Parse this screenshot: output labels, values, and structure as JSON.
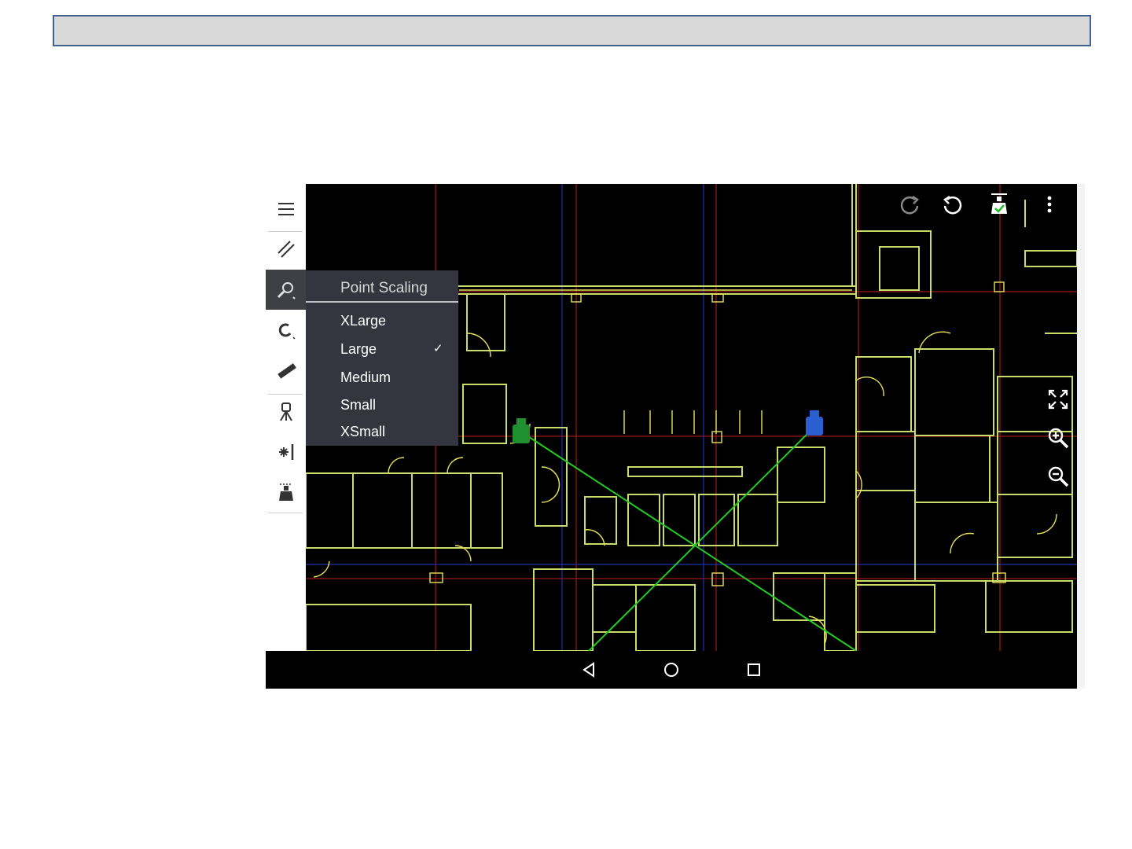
{
  "title_bar": {
    "text": ""
  },
  "sidebar": {
    "tools": [
      {
        "icon": "hamburger-menu-icon"
      },
      {
        "icon": "double-line-icon"
      },
      {
        "icon": "point-scaling-icon",
        "active": true
      },
      {
        "icon": "magnet-icon"
      },
      {
        "icon": "ruler-icon"
      },
      {
        "icon": "surveyor-tripod-icon"
      },
      {
        "icon": "laser-icon"
      },
      {
        "icon": "prism-icon"
      }
    ]
  },
  "point_scaling_menu": {
    "title": "Point Scaling",
    "options": [
      {
        "label": "XLarge",
        "selected": false
      },
      {
        "label": "Large",
        "selected": true
      },
      {
        "label": "Medium",
        "selected": false
      },
      {
        "label": "Small",
        "selected": false
      },
      {
        "label": "XSmall",
        "selected": false
      }
    ],
    "check_glyph": "✓"
  },
  "top_toolbar": {
    "icons": [
      "redo-icon",
      "undo-icon",
      "station-check-icon",
      "more-vert-icon"
    ]
  },
  "view_controls": {
    "icons": [
      "fit-extents-icon",
      "zoom-in-icon",
      "zoom-out-icon"
    ]
  },
  "nav_bar": {
    "icons": [
      "back-icon",
      "home-icon",
      "recents-icon"
    ]
  },
  "colors": {
    "walls": "#c8dc6a",
    "walls_alt": "#e8e25a",
    "grid_red": "#b02020",
    "grid_blue": "#2030b0",
    "survey_lines": "#22cc22",
    "station_green": "#1f8f2f",
    "station_blue": "#2b5fd0",
    "menu_bg": "#34353f"
  }
}
